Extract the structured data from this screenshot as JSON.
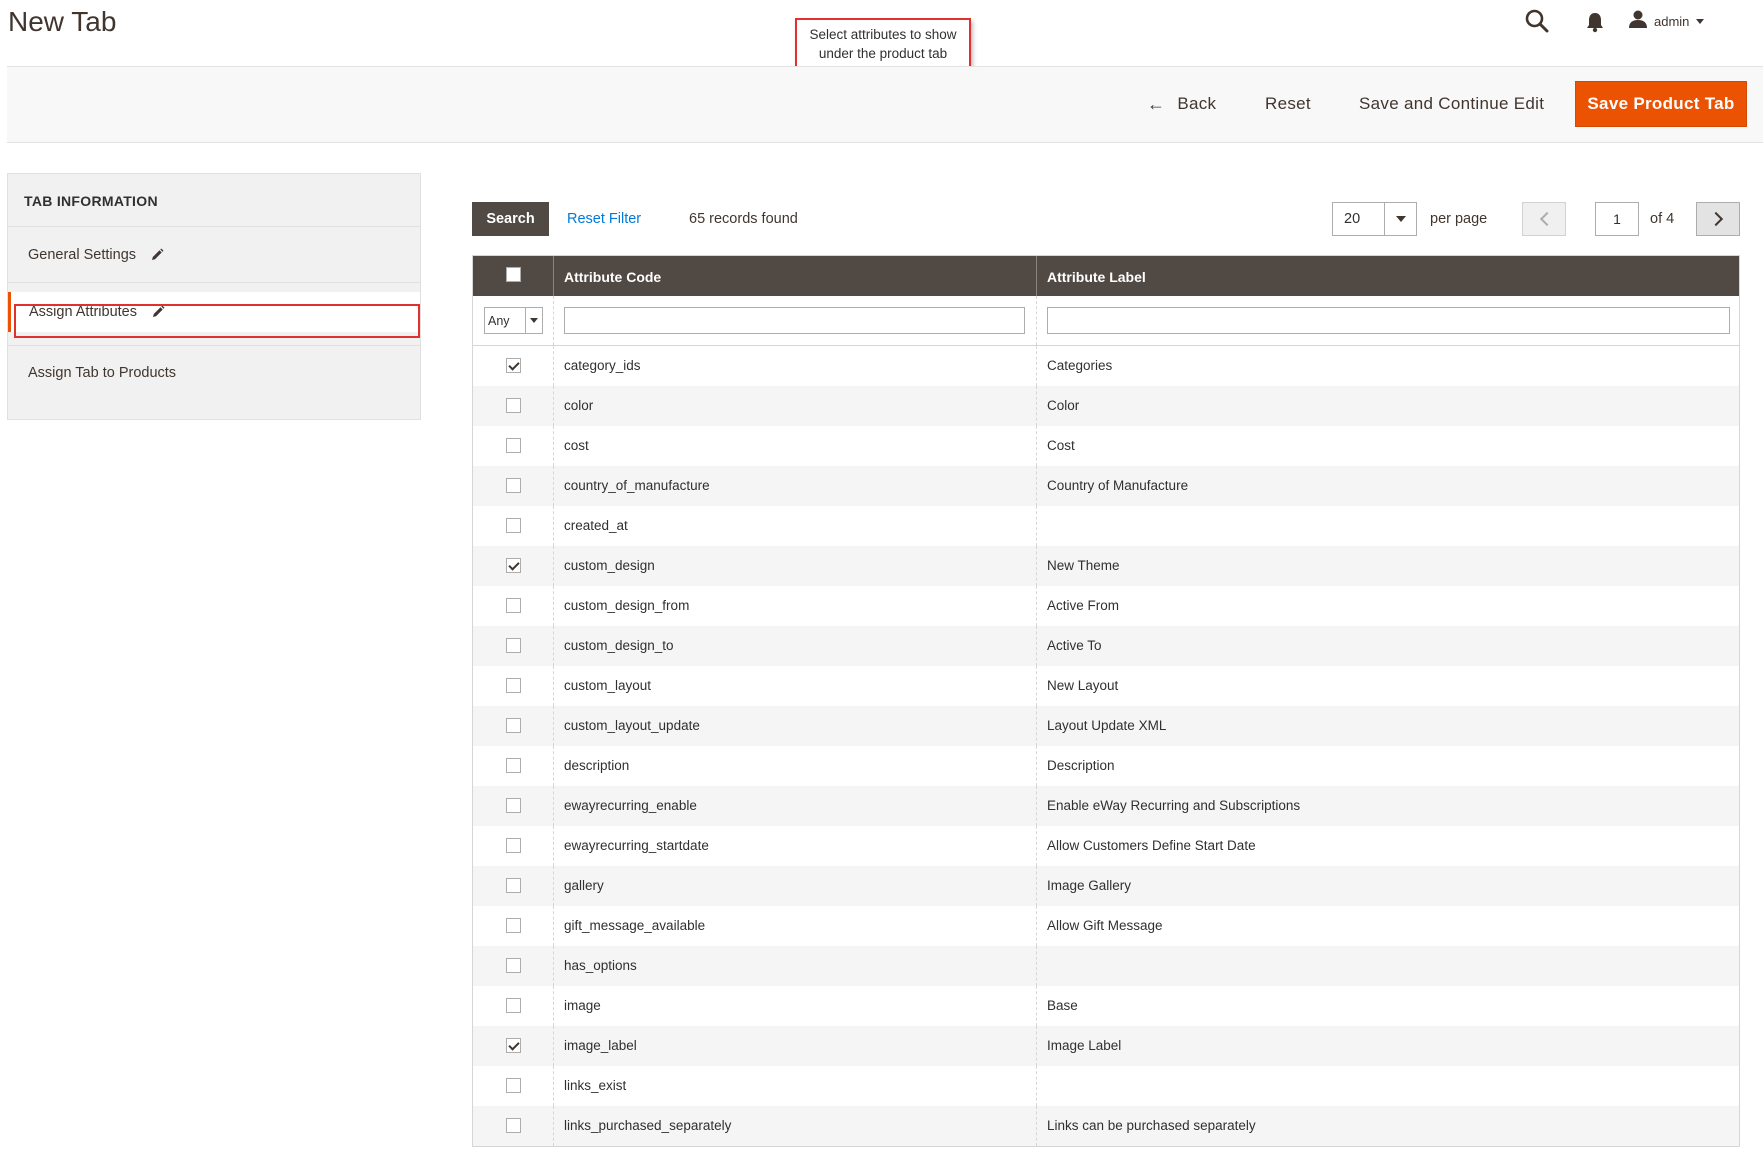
{
  "page": {
    "title": "New Tab"
  },
  "callout": {
    "line1": "Select attributes to show",
    "line2": "under the product tab"
  },
  "header": {
    "user_name": "admin"
  },
  "actions": {
    "back_label": "Back",
    "reset_label": "Reset",
    "save_continue_label": "Save and Continue Edit",
    "save_label": "Save Product Tab",
    "accent_color": "#eb5202"
  },
  "sidebar": {
    "heading": "TAB INFORMATION",
    "items": [
      {
        "label": "General Settings"
      },
      {
        "label": "Assign Attributes"
      },
      {
        "label": "Assign Tab to Products"
      }
    ]
  },
  "grid_toolbar": {
    "search_label": "Search",
    "reset_filter_label": "Reset Filter",
    "records_found": "65 records found",
    "per_page_value": "20",
    "per_page_label": "per page",
    "current_page": "1",
    "page_total": "of 4"
  },
  "grid": {
    "columns": {
      "code": "Attribute Code",
      "label": "Attribute Label"
    },
    "filter_any": "Any",
    "rows": [
      {
        "checked": true,
        "code": "category_ids",
        "label": "Categories"
      },
      {
        "checked": false,
        "code": "color",
        "label": "Color"
      },
      {
        "checked": false,
        "code": "cost",
        "label": "Cost"
      },
      {
        "checked": false,
        "code": "country_of_manufacture",
        "label": "Country of Manufacture"
      },
      {
        "checked": false,
        "code": "created_at",
        "label": ""
      },
      {
        "checked": true,
        "code": "custom_design",
        "label": "New Theme"
      },
      {
        "checked": false,
        "code": "custom_design_from",
        "label": "Active From"
      },
      {
        "checked": false,
        "code": "custom_design_to",
        "label": "Active To"
      },
      {
        "checked": false,
        "code": "custom_layout",
        "label": "New Layout"
      },
      {
        "checked": false,
        "code": "custom_layout_update",
        "label": "Layout Update XML"
      },
      {
        "checked": false,
        "code": "description",
        "label": "Description"
      },
      {
        "checked": false,
        "code": "ewayrecurring_enable",
        "label": "Enable eWay Recurring and Subscriptions"
      },
      {
        "checked": false,
        "code": "ewayrecurring_startdate",
        "label": "Allow Customers Define Start Date"
      },
      {
        "checked": false,
        "code": "gallery",
        "label": "Image Gallery"
      },
      {
        "checked": false,
        "code": "gift_message_available",
        "label": "Allow Gift Message"
      },
      {
        "checked": false,
        "code": "has_options",
        "label": ""
      },
      {
        "checked": false,
        "code": "image",
        "label": "Base"
      },
      {
        "checked": true,
        "code": "image_label",
        "label": "Image Label"
      },
      {
        "checked": false,
        "code": "links_exist",
        "label": ""
      },
      {
        "checked": false,
        "code": "links_purchased_separately",
        "label": "Links can be purchased separately"
      }
    ]
  }
}
